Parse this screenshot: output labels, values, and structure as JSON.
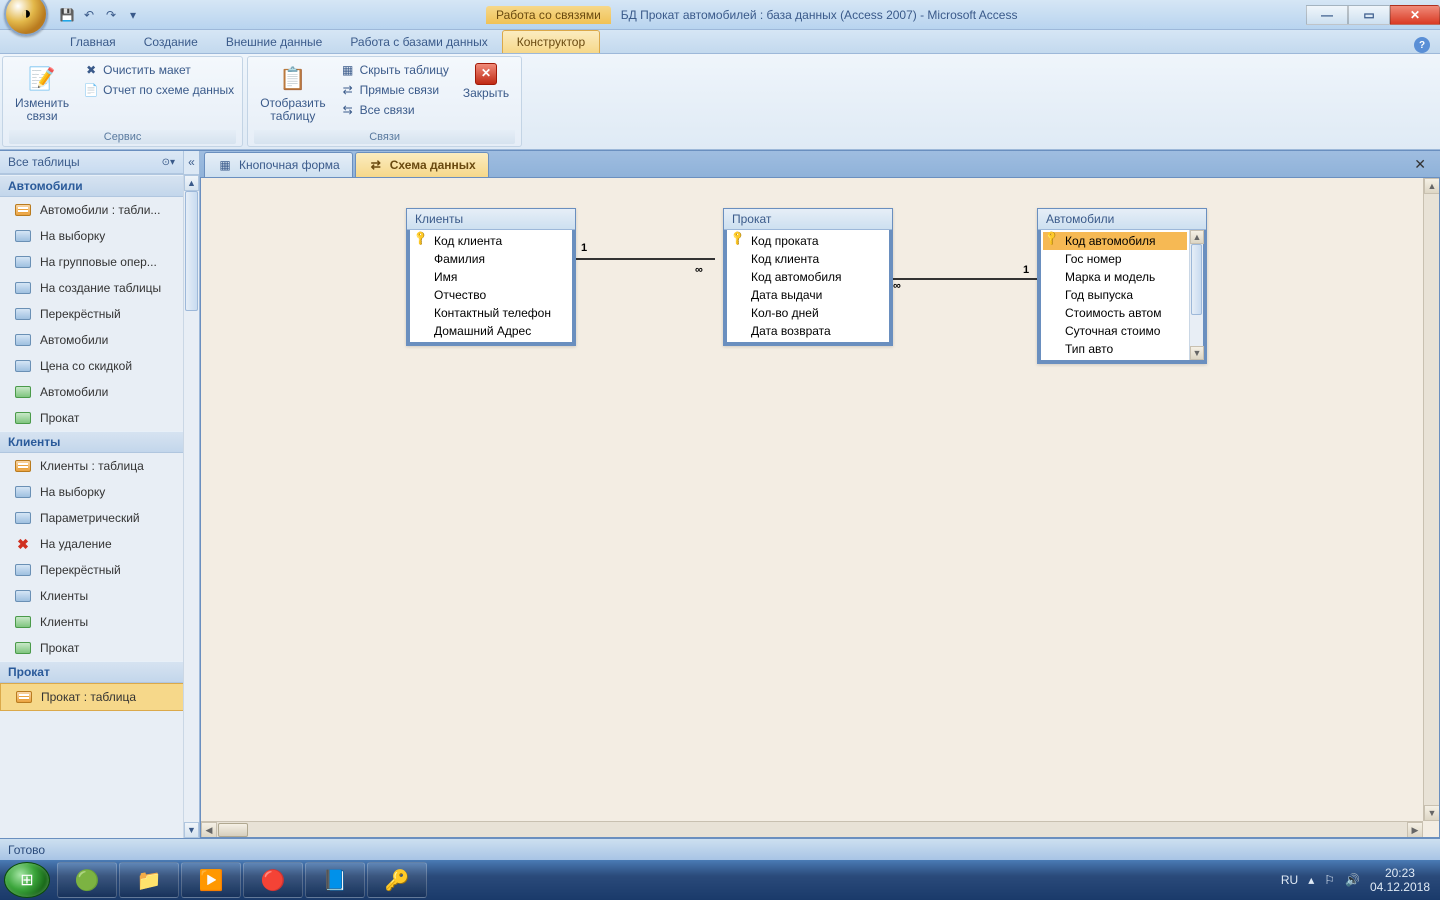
{
  "titlebar": {
    "context": "Работа со связями",
    "title": "БД Прокат автомобилей : база данных (Access 2007) - Microsoft Access"
  },
  "ribbon_tabs": {
    "t0": "Главная",
    "t1": "Создание",
    "t2": "Внешние данные",
    "t3": "Работа с базами данных",
    "t4": "Конструктор"
  },
  "ribbon": {
    "g1": {
      "btn_big": "Изменить\nсвязи",
      "btn_clear": "Очистить макет",
      "btn_report": "Отчет по схеме данных",
      "label": "Сервис"
    },
    "g2": {
      "btn_big": "Отобразить\nтаблицу",
      "btn_hide": "Скрыть таблицу",
      "btn_direct": "Прямые связи",
      "btn_all": "Все связи",
      "label": "Связи"
    },
    "g3": {
      "btn_close": "Закрыть"
    }
  },
  "nav": {
    "header": "Все таблицы",
    "g1": {
      "hdr": "Автомобили",
      "i0": "Автомобили : табли...",
      "i1": "На выборку",
      "i2": "На групповые опер...",
      "i3": "На создание таблицы",
      "i4": "Перекрёстный",
      "i5": "Автомобили",
      "i6": "Цена со скидкой",
      "i7": "Автомобили",
      "i8": "Прокат"
    },
    "g2": {
      "hdr": "Клиенты",
      "i0": "Клиенты : таблица",
      "i1": "На выборку",
      "i2": "Параметрический",
      "i3": "На удаление",
      "i4": "Перекрёстный",
      "i5": "Клиенты",
      "i6": "Клиенты",
      "i7": "Прокат"
    },
    "g3": {
      "hdr": "Прокат",
      "i0": "Прокат : таблица"
    }
  },
  "doc_tabs": {
    "t0": "Кнопочная форма",
    "t1": "Схема данных"
  },
  "tables": {
    "clients": {
      "title": "Клиенты",
      "f0": "Код клиента",
      "f1": "Фамилия",
      "f2": "Имя",
      "f3": "Отчество",
      "f4": "Контактный телефон",
      "f5": "Домашний Адрес"
    },
    "rental": {
      "title": "Прокат",
      "f0": "Код проката",
      "f1": "Код клиента",
      "f2": "Код автомобиля",
      "f3": "Дата выдачи",
      "f4": "Кол-во дней",
      "f5": "Дата возврата"
    },
    "cars": {
      "title": "Автомобили",
      "f0": "Код автомобиля",
      "f1": "Гос номер",
      "f2": "Марка и модель",
      "f3": "Год выпуска",
      "f4": "Стоимость автом",
      "f5": "Суточная стоимо",
      "f6": "Тип авто"
    }
  },
  "rel": {
    "one": "1",
    "many": "∞"
  },
  "statusbar": {
    "text": "Готово"
  },
  "tray": {
    "lang": "RU",
    "time": "20:23",
    "date": "04.12.2018"
  }
}
